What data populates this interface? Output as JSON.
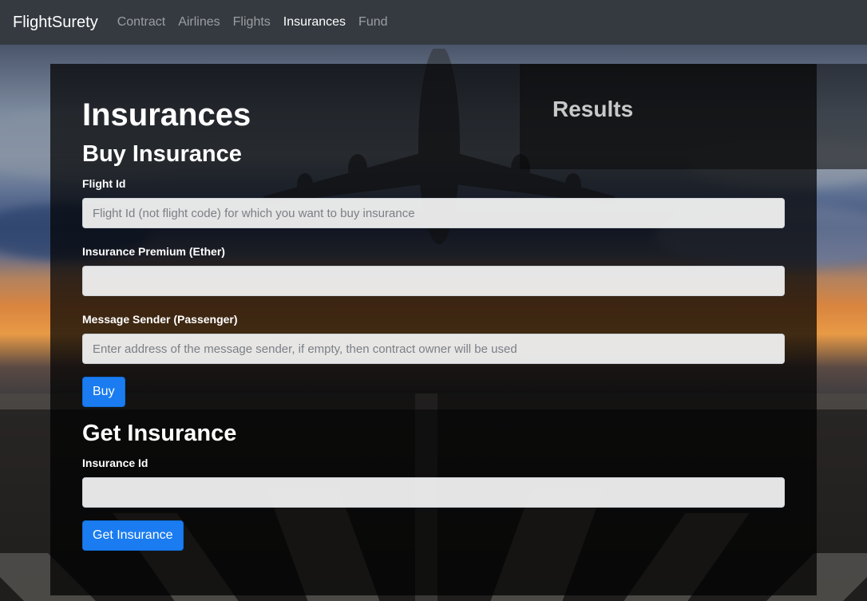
{
  "navbar": {
    "brand": "FlightSurety",
    "links": [
      "Contract",
      "Airlines",
      "Flights",
      "Insurances",
      "Fund"
    ],
    "active": "Insurances"
  },
  "page": {
    "title": "Insurances",
    "results_title": "Results"
  },
  "buy_insurance": {
    "heading": "Buy Insurance",
    "flight_id_label": "Flight Id",
    "flight_id_placeholder": "Flight Id (not flight code) for which you want to buy insurance",
    "flight_id_value": "",
    "premium_label": "Insurance Premium (Ether)",
    "premium_value": "",
    "sender_label": "Message Sender (Passenger)",
    "sender_placeholder": "Enter address of the message sender, if empty, then contract owner will be used",
    "sender_value": "",
    "button_label": "Buy"
  },
  "get_insurance": {
    "heading": "Get Insurance",
    "insurance_id_label": "Insurance Id",
    "insurance_id_value": "",
    "button_label": "Get Insurance"
  },
  "colors": {
    "navbar_bg": "#343a40",
    "primary_button": "#1a7cf0"
  }
}
